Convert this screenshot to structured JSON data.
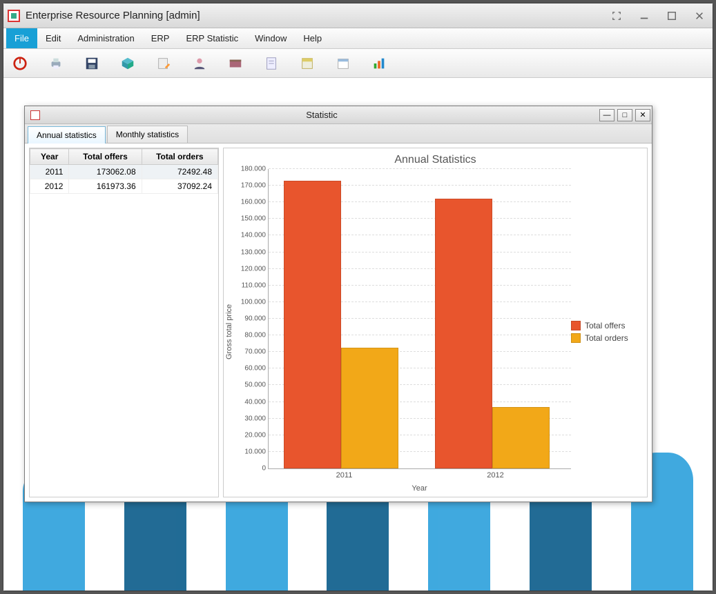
{
  "window": {
    "title": "Enterprise Resource Planning [admin]"
  },
  "menu": {
    "items": [
      "File",
      "Edit",
      "Administration",
      "ERP",
      "ERP Statistic",
      "Window",
      "Help"
    ],
    "active_index": 0
  },
  "toolbar_icons": [
    "power-icon",
    "print-icon",
    "save-icon",
    "box-icon",
    "edit-icon",
    "user-icon",
    "catalog-icon",
    "document-icon",
    "orders-icon",
    "calendar-icon",
    "chart-icon"
  ],
  "inner": {
    "title": "Statistic",
    "tabs": [
      "Annual statistics",
      "Monthly statistics"
    ],
    "active_tab": 0,
    "table": {
      "headers": [
        "Year",
        "Total offers",
        "Total orders"
      ],
      "rows": [
        {
          "year": "2011",
          "offers": "173062.08",
          "orders": "72492.48"
        },
        {
          "year": "2012",
          "offers": "161973.36",
          "orders": "37092.24"
        }
      ]
    }
  },
  "chart_data": {
    "type": "bar",
    "title": "Annual Statistics",
    "xlabel": "Year",
    "ylabel": "Gross total price",
    "categories": [
      "2011",
      "2012"
    ],
    "series": [
      {
        "name": "Total offers",
        "values": [
          173062.08,
          161973.36
        ],
        "color": "#e8552d"
      },
      {
        "name": "Total orders",
        "values": [
          72492.48,
          37092.24
        ],
        "color": "#f2a818"
      }
    ],
    "ylim": [
      0,
      180000
    ],
    "ytick_step": 10000,
    "ytick_labels": [
      "0",
      "10.000",
      "20.000",
      "30.000",
      "40.000",
      "50.000",
      "60.000",
      "70.000",
      "80.000",
      "90.000",
      "100.000",
      "110.000",
      "120.000",
      "130.000",
      "140.000",
      "150.000",
      "160.000",
      "170.000",
      "180.000"
    ],
    "legend": [
      "Total offers",
      "Total orders"
    ]
  }
}
